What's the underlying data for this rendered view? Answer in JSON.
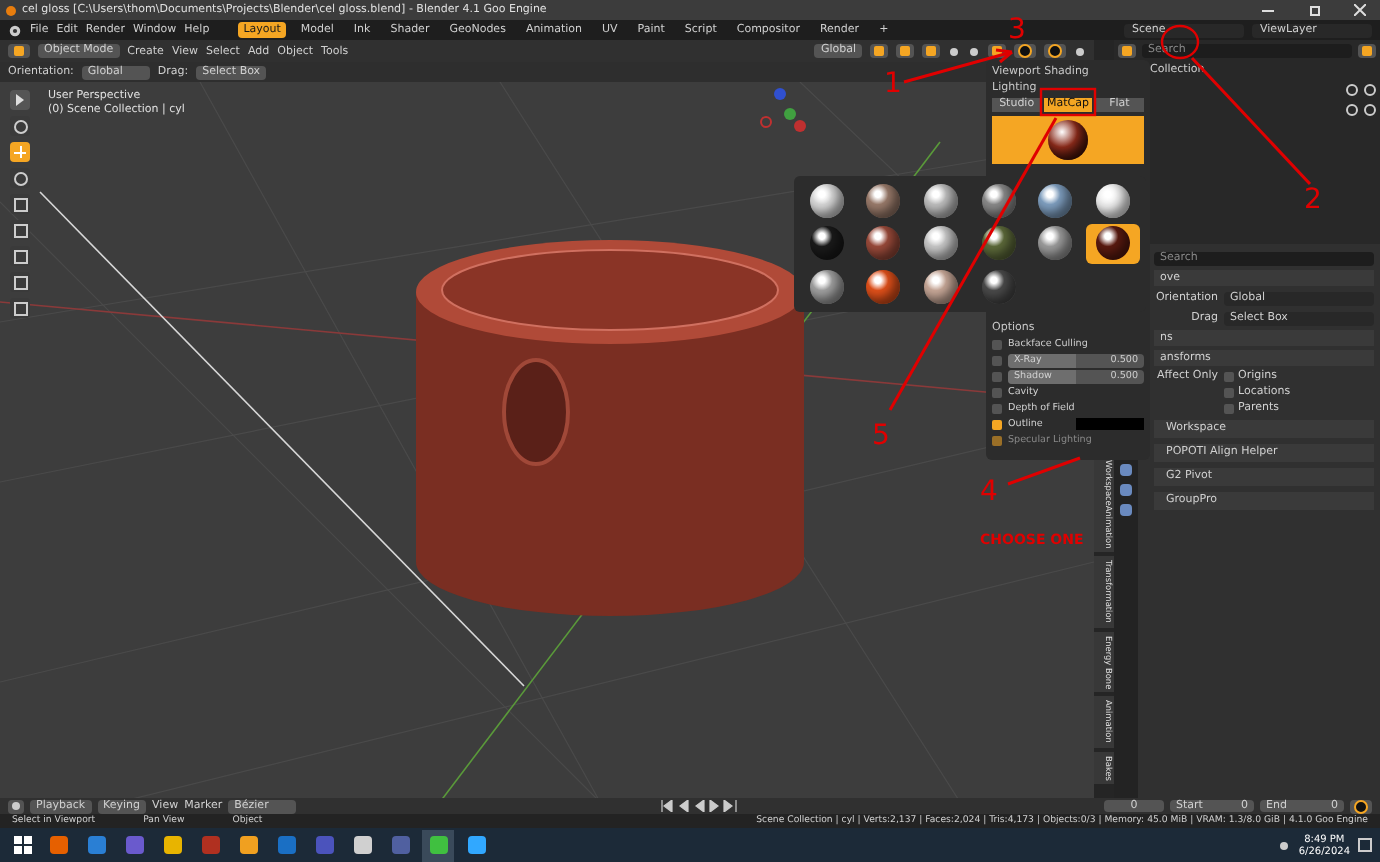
{
  "window": {
    "title": "cel gloss [C:\\Users\\thom\\Documents\\Projects\\Blender\\cel gloss.blend] - Blender 4.1 Goo Engine"
  },
  "menu": [
    "File",
    "Edit",
    "Render",
    "Window",
    "Help"
  ],
  "workspaces": [
    {
      "label": "Layout",
      "selected": true
    },
    {
      "label": "Model",
      "selected": false
    },
    {
      "label": "Ink",
      "selected": false
    },
    {
      "label": "Shader",
      "selected": false
    },
    {
      "label": "GeoNodes",
      "selected": false
    },
    {
      "label": "Animation",
      "selected": false
    },
    {
      "label": "UV",
      "selected": false
    },
    {
      "label": "Paint",
      "selected": false
    },
    {
      "label": "Script",
      "selected": false
    },
    {
      "label": "Compositor",
      "selected": false
    },
    {
      "label": "Render",
      "selected": false
    }
  ],
  "add_workspace": "+",
  "scene": "Scene",
  "view_layer": "ViewLayer",
  "viewport": {
    "mode": "Object Mode",
    "menus": [
      "Create",
      "View",
      "Select",
      "Add",
      "Object",
      "Tools"
    ],
    "transform_orientation": "Global",
    "orientation_label": "Orientation:",
    "orientation": "Global",
    "drag_label": "Drag:",
    "drag": "Select Box",
    "info": [
      "User Perspective",
      "(0) Scene Collection | cyl"
    ]
  },
  "outliner": {
    "search_placeholder": "Search",
    "items": [
      "Collection"
    ]
  },
  "sidebar_tabs": [
    "WorkspaceAnimation",
    "Transformation",
    "Energy Bone",
    "Animation",
    "Bakes"
  ],
  "properties": {
    "search_placeholder": "Search",
    "header": "ove",
    "orientation_label": "Orientation",
    "orientation": "Global",
    "drag_label": "Drag",
    "drag": "Select Box",
    "sub_headers": [
      "ns",
      "ansforms"
    ],
    "affect_label": "Affect Only",
    "affect": [
      {
        "label": "Origins",
        "checked": false
      },
      {
        "label": "Locations",
        "checked": false
      },
      {
        "label": "Parents",
        "checked": false
      }
    ],
    "panels": [
      "Workspace",
      "POPOTI Align Helper",
      "G2 Pivot",
      "GroupPro"
    ]
  },
  "shading": {
    "title": "Viewport Shading",
    "lighting_label": "Lighting",
    "lighting": [
      {
        "label": "Studio",
        "selected": false
      },
      {
        "label": "MatCap",
        "selected": true
      },
      {
        "label": "Flat",
        "selected": false
      }
    ],
    "matcaps": [
      {
        "color": "#d8d8d8",
        "selected": false
      },
      {
        "color": "#9a7b6b",
        "selected": false
      },
      {
        "color": "#bfbfbf",
        "selected": false
      },
      {
        "color": "#8a8a8a",
        "selected": false
      },
      {
        "color": "#7f9fc0",
        "selected": false
      },
      {
        "color": "#f0f0f0",
        "selected": false
      },
      {
        "color": "#1a1a1a",
        "selected": false
      },
      {
        "color": "#9a4a3a",
        "selected": false
      },
      {
        "color": "#c8c8c8",
        "selected": false
      },
      {
        "color": "#5d6a3a",
        "selected": false
      },
      {
        "color": "#9c9c9c",
        "selected": false
      },
      {
        "color": "#5a1a10",
        "selected": true
      },
      {
        "color": "#a0a0a0",
        "selected": false
      },
      {
        "color": "#e0501a",
        "selected": false
      },
      {
        "color": "#c8a898",
        "selected": false
      },
      {
        "color": "#4a4a4a",
        "selected": false
      }
    ],
    "options_label": "Options",
    "options": [
      {
        "kind": "check",
        "label": "Backface Culling",
        "checked": false,
        "disabled": false
      },
      {
        "kind": "slider",
        "label": "X-Ray",
        "value": "0.500",
        "level": 0.5,
        "checked": false,
        "disabled": false
      },
      {
        "kind": "slider",
        "label": "Shadow",
        "value": "0.500",
        "level": 0.5,
        "checked": false,
        "disabled": false
      },
      {
        "kind": "check",
        "label": "Cavity",
        "checked": false,
        "disabled": false
      },
      {
        "kind": "check",
        "label": "Depth of Field",
        "checked": false,
        "disabled": false
      },
      {
        "kind": "color",
        "label": "Outline",
        "checked": true,
        "disabled": false,
        "color": "#000000"
      },
      {
        "kind": "check",
        "label": "Specular Lighting",
        "checked": true,
        "disabled": true
      }
    ]
  },
  "annotations": [
    "1",
    "2",
    "3",
    "4",
    "5",
    "CHOOSE ONE"
  ],
  "timeline": {
    "playback": "Playback",
    "keying": "Keying",
    "menus": [
      "View",
      "Marker"
    ],
    "interpolation": "Bézier",
    "frame": "0",
    "start_label": "Start",
    "start": "0",
    "end_label": "End",
    "end": "0"
  },
  "status": {
    "hints": [
      "Select in Viewport",
      "Pan View",
      "Object"
    ],
    "stats": "Scene Collection | cyl | Verts:2,137 | Faces:2,024 | Tris:4,173 | Objects:0/3 | Memory: 45.0 MiB | VRAM: 1.3/8.0 GiB | 4.1.0 Goo Engine"
  },
  "taskbar": {
    "apps": [
      {
        "color": "#e66000",
        "selected": false
      },
      {
        "color": "#2a7fd4",
        "selected": false
      },
      {
        "color": "#6a5acd",
        "selected": false
      },
      {
        "color": "#e8b400",
        "selected": false
      },
      {
        "color": "#b03020",
        "selected": false
      },
      {
        "color": "#f0a020",
        "selected": false
      },
      {
        "color": "#1a6fc4",
        "selected": false
      },
      {
        "color": "#4b53bc",
        "selected": false
      },
      {
        "color": "#d0d0d0",
        "selected": false
      },
      {
        "color": "#5060a0",
        "selected": false
      },
      {
        "color": "#40c040",
        "selected": true
      },
      {
        "color": "#31a8ff",
        "selected": false
      }
    ],
    "time": "8:49 PM",
    "date": "6/26/2024"
  }
}
